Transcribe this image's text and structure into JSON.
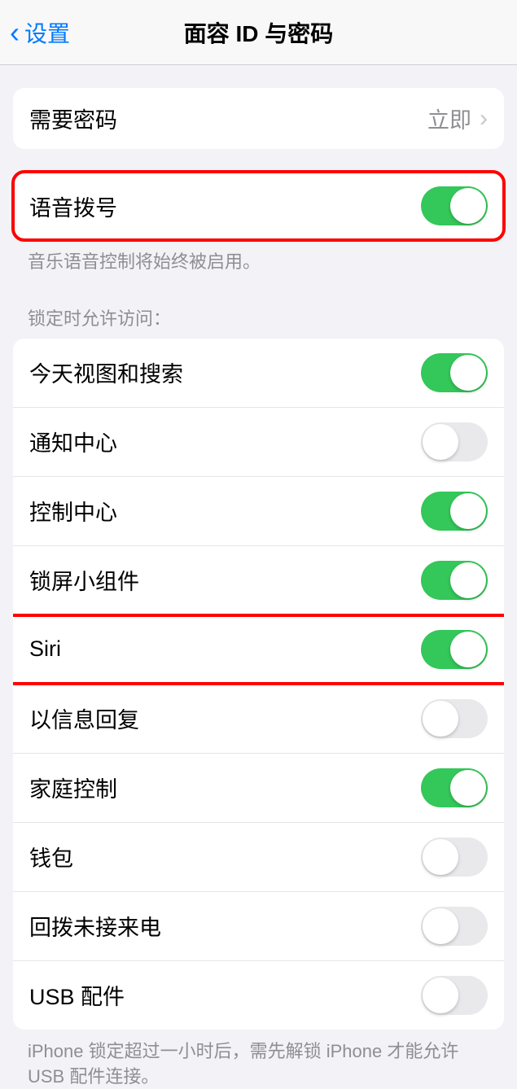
{
  "header": {
    "back_label": "设置",
    "title": "面容 ID 与密码"
  },
  "passcode": {
    "label": "需要密码",
    "value": "立即"
  },
  "voice_dial": {
    "label": "语音拨号",
    "on": true,
    "footer": "音乐语音控制将始终被启用。"
  },
  "lock_section": {
    "header": "锁定时允许访问：",
    "items": [
      {
        "label": "今天视图和搜索",
        "on": true
      },
      {
        "label": "通知中心",
        "on": false
      },
      {
        "label": "控制中心",
        "on": true
      },
      {
        "label": "锁屏小组件",
        "on": true
      },
      {
        "label": "Siri",
        "on": true
      },
      {
        "label": "以信息回复",
        "on": false
      },
      {
        "label": "家庭控制",
        "on": true
      },
      {
        "label": "钱包",
        "on": false
      },
      {
        "label": "回拨未接来电",
        "on": false
      },
      {
        "label": "USB 配件",
        "on": false
      }
    ],
    "footer": "iPhone 锁定超过一小时后，需先解锁 iPhone 才能允许 USB 配件连接。"
  }
}
